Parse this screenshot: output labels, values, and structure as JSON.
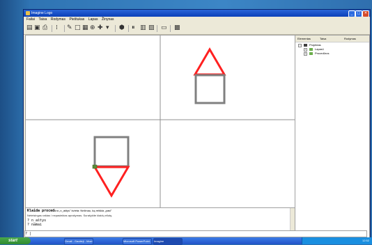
{
  "window": {
    "title": "Imagine Logo"
  },
  "window_controls": {
    "minimize": "_",
    "maximize": "□",
    "close": "✕"
  },
  "menu": [
    "Failai",
    "Taisa",
    "Rodymas",
    "Pieštukas",
    "Lapas",
    "Žinynas"
  ],
  "right_panel": {
    "tabs": [
      "Elementas",
      "Taisa",
      "Rodymas"
    ],
    "tree": {
      "root": "Projektas",
      "children": [
        "Lapas1",
        "Procedūros"
      ]
    }
  },
  "console": {
    "lines": [
      {
        "text": "Klaida proced",
        "rest": "ūra „n_aštys\" kvieta: Nežinau, ką reiškia „pasi\""
      },
      {
        "text": "Neteisingas raštas / nepasiektas aprašymas. Surašykite klaidų eilutę."
      },
      {
        "text": "? n_aštys"
      },
      {
        "text": "? namai"
      }
    ],
    "prompt": "? |"
  },
  "taskbar": {
    "start_label": "start",
    "tasks": [
      "Gmail - Gautieji - Mozi...",
      "Microsoft PowerPoint ...",
      "Imagine"
    ],
    "clock": "12:52"
  },
  "colors": {
    "house_roof": "#ff2020",
    "house_body": "#808080",
    "accent": "#2a66d8"
  }
}
